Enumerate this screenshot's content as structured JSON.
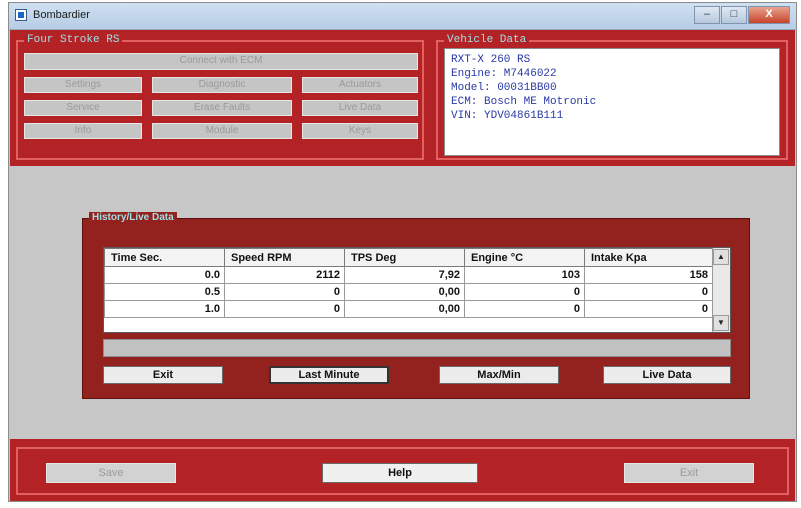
{
  "window": {
    "title": "Bombardier",
    "controls": {
      "minimize": "–",
      "maximize": "□",
      "close": "X"
    }
  },
  "four_stroke": {
    "title": "Four Stroke RS",
    "connect_label": "Connect with ECM",
    "buttons": [
      [
        "Settings",
        "Diagnostic",
        "Actuators"
      ],
      [
        "Service",
        "Erase Faults",
        "Live Data"
      ],
      [
        "Info",
        "Module",
        "Keys"
      ]
    ]
  },
  "vehicle": {
    "title": "Vehicle Data",
    "lines": [
      "RXT-X 260 RS",
      "Engine: M7446022",
      "Model: 00031BB00",
      "ECM: Bosch ME Motronic",
      "VIN: YDV04861B111"
    ]
  },
  "history": {
    "title": "History/Live Data",
    "columns": [
      "Time Sec.",
      "Speed RPM",
      "TPS Deg",
      "Engine °C",
      "Intake Kpa"
    ],
    "rows": [
      [
        "0.0",
        "2112",
        "7,92",
        "103",
        "158"
      ],
      [
        "0.5",
        "0",
        "0,00",
        "0",
        "0"
      ],
      [
        "1.0",
        "0",
        "0,00",
        "0",
        "0"
      ]
    ],
    "buttons": {
      "exit": "Exit",
      "last_minute": "Last Minute",
      "max_min": "Max/Min",
      "live_data": "Live Data"
    }
  },
  "footer": {
    "save": "Save",
    "help": "Help",
    "exit": "Exit"
  },
  "colors": {
    "frame_red": "#b32225",
    "panel_red": "#93211e",
    "group_border": "#e26060",
    "title_cyan": "#9de0e6",
    "vehicle_text": "#2a3aa6"
  }
}
